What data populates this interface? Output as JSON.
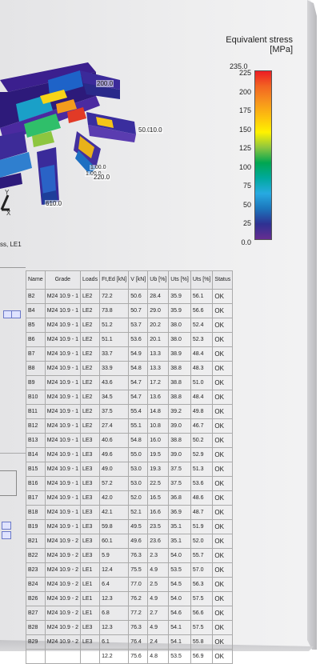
{
  "model": {
    "labels": [
      "200.0",
      "50.0",
      "10.0",
      "1.00.0",
      "1.00.0",
      "220.0",
      "610.0"
    ],
    "axis_y": "Y",
    "axis_x": "X",
    "caption": "ss, LE1"
  },
  "legend": {
    "title": "Equivalent stress",
    "unit": "[MPa]",
    "max": "235.0",
    "ticks": [
      "225",
      "200",
      "175",
      "150",
      "125",
      "100",
      "75",
      "50",
      "25",
      "0.0"
    ],
    "colors": [
      "#ed1c24",
      "#f26522",
      "#f7941d",
      "#fdc10e",
      "#fff200",
      "#8dc63f",
      "#00a651",
      "#00a99d",
      "#27aae1",
      "#1c75bc",
      "#2e3192",
      "#662d91"
    ]
  },
  "table": {
    "headers": [
      "Name",
      "Grade",
      "Loads",
      "Ft,Ed [kN]",
      "V [kN]",
      "Ub [%]",
      "Uts [%]",
      "Uts [%]",
      "Status"
    ],
    "rows": [
      [
        "B2",
        "M24 10.9 - 1",
        "LE2",
        "72.2",
        "50.6",
        "28.4",
        "35.9",
        "56.1",
        "OK"
      ],
      [
        "B4",
        "M24 10.9 - 1",
        "LE2",
        "73.8",
        "50.7",
        "29.0",
        "35.9",
        "56.6",
        "OK"
      ],
      [
        "B5",
        "M24 10.9 - 1",
        "LE2",
        "51.2",
        "53.7",
        "20.2",
        "38.0",
        "52.4",
        "OK"
      ],
      [
        "B6",
        "M24 10.9 - 1",
        "LE2",
        "51.1",
        "53.6",
        "20.1",
        "38.0",
        "52.3",
        "OK"
      ],
      [
        "B7",
        "M24 10.9 - 1",
        "LE2",
        "33.7",
        "54.9",
        "13.3",
        "38.9",
        "48.4",
        "OK"
      ],
      [
        "B8",
        "M24 10.9 - 1",
        "LE2",
        "33.9",
        "54.8",
        "13.3",
        "38.8",
        "48.3",
        "OK"
      ],
      [
        "B9",
        "M24 10.9 - 1",
        "LE2",
        "43.6",
        "54.7",
        "17.2",
        "38.8",
        "51.0",
        "OK"
      ],
      [
        "B10",
        "M24 10.9 - 1",
        "LE2",
        "34.5",
        "54.7",
        "13.6",
        "38.8",
        "48.4",
        "OK"
      ],
      [
        "B11",
        "M24 10.9 - 1",
        "LE2",
        "37.5",
        "55.4",
        "14.8",
        "39.2",
        "49.8",
        "OK"
      ],
      [
        "B12",
        "M24 10.9 - 1",
        "LE2",
        "27.4",
        "55.1",
        "10.8",
        "39.0",
        "46.7",
        "OK"
      ],
      [
        "B13",
        "M24 10.9 - 1",
        "LE3",
        "40.6",
        "54.8",
        "16.0",
        "38.8",
        "50.2",
        "OK"
      ],
      [
        "B14",
        "M24 10.9 - 1",
        "LE3",
        "49.6",
        "55.0",
        "19.5",
        "39.0",
        "52.9",
        "OK"
      ],
      [
        "B15",
        "M24 10.9 - 1",
        "LE3",
        "49.0",
        "53.0",
        "19.3",
        "37.5",
        "51.3",
        "OK"
      ],
      [
        "B16",
        "M24 10.9 - 1",
        "LE3",
        "57.2",
        "53.0",
        "22.5",
        "37.5",
        "53.6",
        "OK"
      ],
      [
        "B17",
        "M24 10.9 - 1",
        "LE3",
        "42.0",
        "52.0",
        "16.5",
        "36.8",
        "48.6",
        "OK"
      ],
      [
        "B18",
        "M24 10.9 - 1",
        "LE3",
        "42.1",
        "52.1",
        "16.6",
        "36.9",
        "48.7",
        "OK"
      ],
      [
        "B19",
        "M24 10.9 - 1",
        "LE3",
        "59.8",
        "49.5",
        "23.5",
        "35.1",
        "51.9",
        "OK"
      ],
      [
        "B21",
        "M24 10.9 - 2",
        "LE3",
        "60.1",
        "49.6",
        "23.6",
        "35.1",
        "52.0",
        "OK"
      ],
      [
        "B22",
        "M24 10.9 - 2",
        "LE3",
        "5.9",
        "76.3",
        "2.3",
        "54.0",
        "55.7",
        "OK"
      ],
      [
        "B23",
        "M24 10.9 - 2",
        "LE1",
        "12.4",
        "75.5",
        "4.9",
        "53.5",
        "57.0",
        "OK"
      ],
      [
        "B24",
        "M24 10.9 - 2",
        "LE1",
        "6.4",
        "77.0",
        "2.5",
        "54.5",
        "56.3",
        "OK"
      ],
      [
        "B26",
        "M24 10.9 - 2",
        "LE1",
        "12.3",
        "76.2",
        "4.9",
        "54.0",
        "57.5",
        "OK"
      ],
      [
        "B27",
        "M24 10.9 - 2",
        "LE1",
        "6.8",
        "77.2",
        "2.7",
        "54.6",
        "56.6",
        "OK"
      ],
      [
        "B28",
        "M24 10.9 - 2",
        "LE3",
        "12.3",
        "76.3",
        "4.9",
        "54.1",
        "57.5",
        "OK"
      ],
      [
        "B29",
        "M24 10.9 - 2",
        "LE3",
        "6.1",
        "76.4",
        "2.4",
        "54.1",
        "55.8",
        "OK"
      ],
      [
        "",
        "",
        "",
        "12.2",
        "75.6",
        "4.8",
        "53.5",
        "56.9",
        "OK"
      ]
    ]
  }
}
